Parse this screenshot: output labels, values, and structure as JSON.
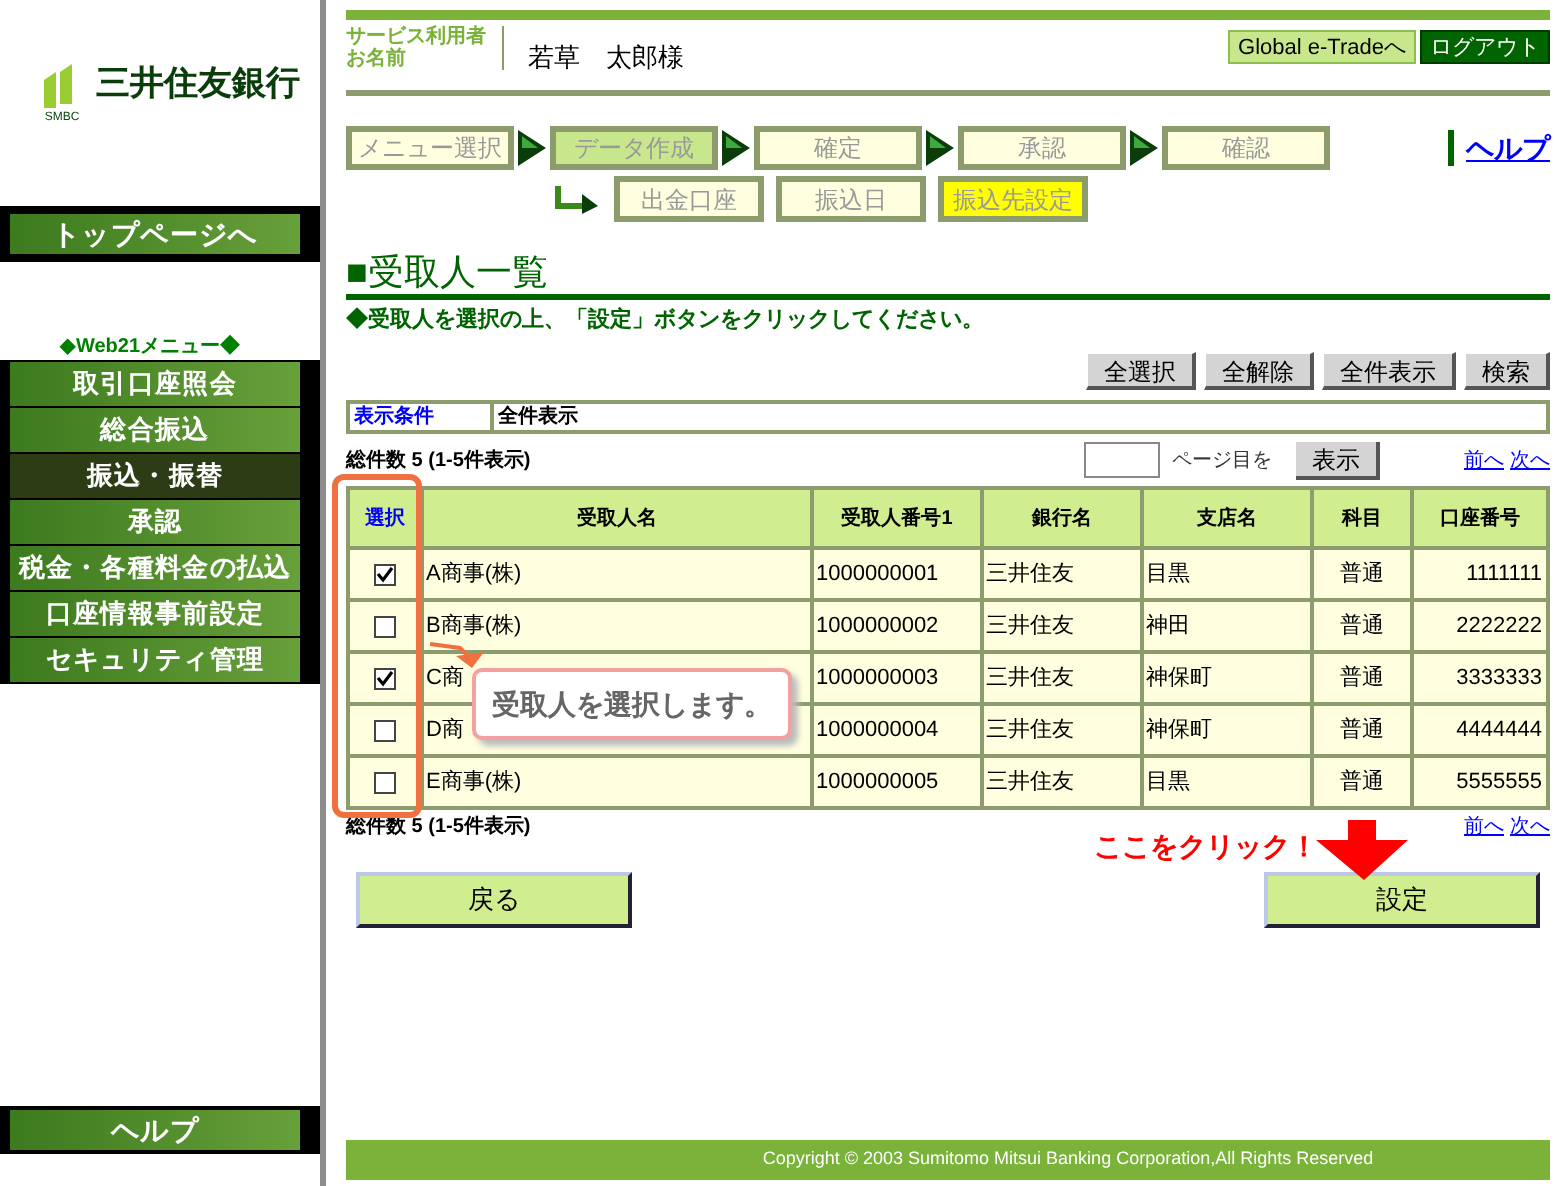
{
  "bank": {
    "name": "三井住友銀行",
    "abbr": "SMBC"
  },
  "sidebar": {
    "top_button": "トップページへ",
    "menu_title": "◆Web21メニュー◆",
    "items": [
      {
        "label": "取引口座照会",
        "selected": false
      },
      {
        "label": "総合振込",
        "selected": false
      },
      {
        "label": "振込・振替",
        "selected": true
      },
      {
        "label": "承認",
        "selected": false
      },
      {
        "label": "税金・各種料金の払込",
        "selected": false
      },
      {
        "label": "口座情報事前設定",
        "selected": false
      },
      {
        "label": "セキュリティ管理",
        "selected": false
      }
    ],
    "help_button": "ヘルプ"
  },
  "header": {
    "user_label": [
      "サービス利用者",
      "お名前"
    ],
    "user_name": "若草　太郎様",
    "buttons": [
      "Global e-Tradeへ",
      "ログアウト"
    ]
  },
  "steps": [
    {
      "label": "メニュー選択",
      "selected": false
    },
    {
      "label": "データ作成",
      "selected": true
    },
    {
      "label": "確定",
      "selected": false
    },
    {
      "label": "承認",
      "selected": false
    },
    {
      "label": "確認",
      "selected": false
    }
  ],
  "substeps": [
    {
      "label": "出金口座",
      "selected": false
    },
    {
      "label": "振込日",
      "selected": false
    },
    {
      "label": "振込先設定",
      "selected": true
    }
  ],
  "help_link": "ヘルプ",
  "title": "■受取人一覧",
  "instruction": "◆受取人を選択の上、「設定」ボタンをクリックしてください。",
  "toolbar": [
    "全選択",
    "全解除",
    "全件表示",
    "検索"
  ],
  "condition": {
    "label": "表示条件",
    "value": "全件表示"
  },
  "count": "総件数 5 (1-5件表示)",
  "page": {
    "suffix": "ページ目を",
    "button": "表示",
    "prev": "前へ",
    "next": "次へ"
  },
  "table": {
    "select_column": "選択",
    "columns": [
      "受取人名",
      "受取人番号1",
      "銀行名",
      "支店名",
      "科目",
      "口座番号"
    ],
    "rows": [
      {
        "checked": true,
        "cells": [
          "A商事(株)",
          "1000000001",
          "三井住友",
          "目黒",
          "普通",
          "1111111"
        ]
      },
      {
        "checked": false,
        "cells": [
          "B商事(株)",
          "1000000002",
          "三井住友",
          "神田",
          "普通",
          "2222222"
        ]
      },
      {
        "checked": true,
        "cells": [
          "C商",
          "1000000003",
          "三井住友",
          "神保町",
          "普通",
          "3333333"
        ]
      },
      {
        "checked": false,
        "cells": [
          "D商",
          "1000000004",
          "三井住友",
          "神保町",
          "普通",
          "4444444"
        ]
      },
      {
        "checked": false,
        "cells": [
          "E商事(株)",
          "1000000005",
          "三井住友",
          "目黒",
          "普通",
          "5555555"
        ]
      }
    ]
  },
  "count_bottom": "総件数 5 (1-5件表示)",
  "page_bottom": {
    "prev": "前へ",
    "next": "次へ"
  },
  "callout": "受取人を選択します。",
  "click_hint": "ここをクリック！",
  "buttons": {
    "back": "戻る",
    "submit": "設定"
  },
  "footer": "Copyright © 2003 Sumitomo Mitsui Banking Corporation,All Rights Reserved"
}
